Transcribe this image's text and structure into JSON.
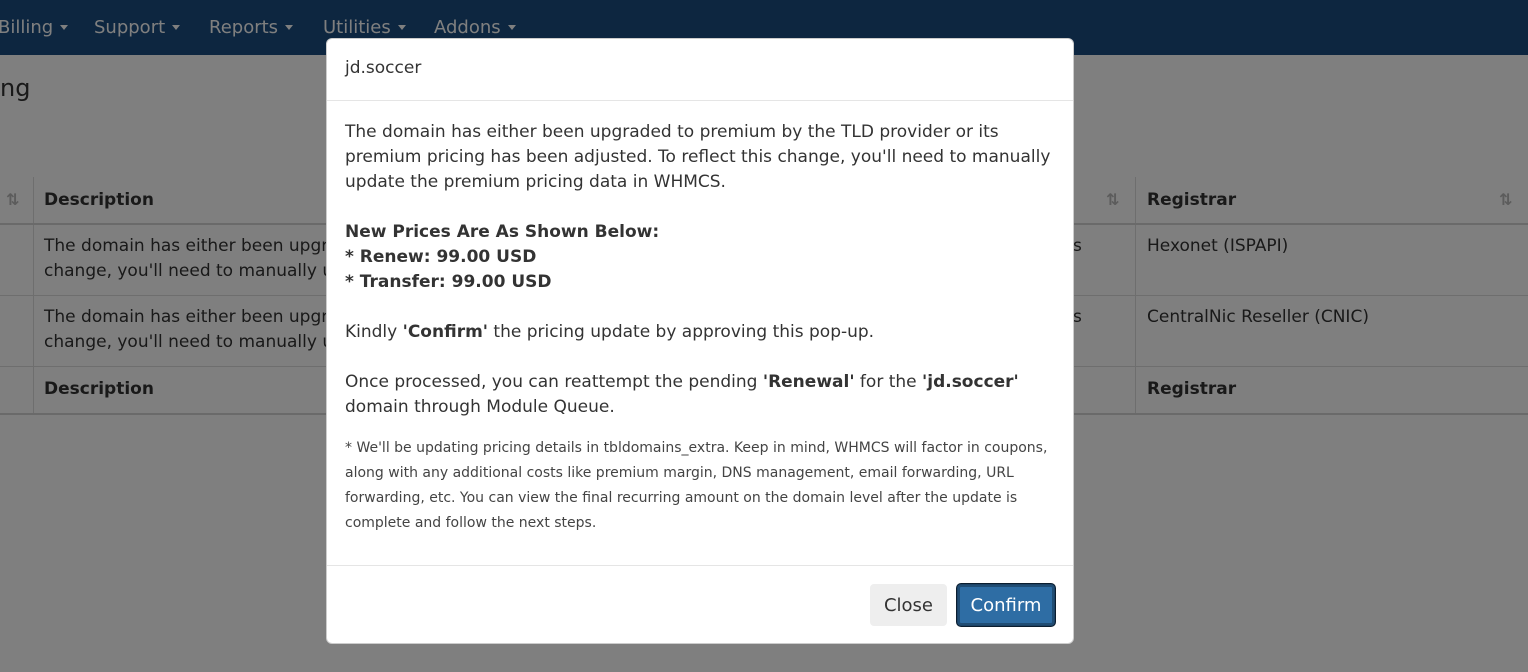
{
  "navbar": {
    "items": [
      {
        "label": "Billing"
      },
      {
        "label": "Support"
      },
      {
        "label": "Reports"
      },
      {
        "label": "Utilities"
      },
      {
        "label": "Addons"
      }
    ]
  },
  "page": {
    "title_fragment": "ng"
  },
  "table": {
    "columns": {
      "description": "Description",
      "registrar": "Registrar"
    },
    "rows": [
      {
        "description_line1": "The domain has either been upgra",
        "description_line2": "change, you'll need to manually up",
        "status_fragment": "s",
        "registrar": "Hexonet (ISPAPI)"
      },
      {
        "description_line1": "The domain has either been upgra",
        "description_line2": "change, you'll need to manually up",
        "status_fragment": "s",
        "registrar": "CentralNic Reseller (CNIC)"
      }
    ],
    "footer": {
      "description": "Description",
      "registrar": "Registrar"
    }
  },
  "modal": {
    "title": "jd.soccer",
    "intro": "The domain has either been upgraded to premium by the TLD provider or its premium pricing has been adjusted. To reflect this change, you'll need to manually update the premium pricing data in WHMCS.",
    "prices_heading": "New Prices Are As Shown Below:",
    "renew_price": "* Renew: 99.00 USD",
    "transfer_price": "* Transfer: 99.00 USD",
    "kindly_prefix": "Kindly ",
    "kindly_bold": "'Confirm'",
    "kindly_suffix": " the pricing update by approving this pop-up.",
    "once_prefix": "Once processed, you can reattempt the pending ",
    "once_bold1": "'Renewal'",
    "once_middle": " for the ",
    "once_bold2": "'jd.soccer'",
    "once_suffix": " domain through Module Queue.",
    "note": "* We'll be updating pricing details in tbldomains_extra. Keep in mind, WHMCS will factor in coupons, along with any additional costs like premium margin, DNS management, email forwarding, URL forwarding, etc. You can view the final recurring amount on the domain level after the update is complete and follow the next steps.",
    "close_label": "Close",
    "confirm_label": "Confirm"
  },
  "colors": {
    "navbar": "#1a4d80",
    "primary_button": "#2e6da4",
    "overlay": "rgba(0,0,0,0.5)"
  }
}
